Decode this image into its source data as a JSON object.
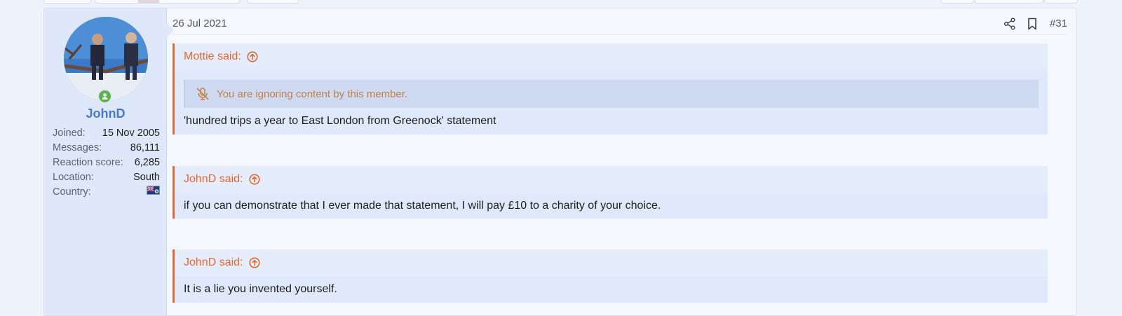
{
  "post": {
    "date": "26 Jul 2021",
    "number": "#31",
    "icons": {
      "share": "share-icon",
      "bookmark": "bookmark-icon",
      "online": "online-status-icon"
    }
  },
  "user": {
    "name": "JohnD",
    "stats": [
      {
        "label": "Joined:",
        "value": "15 Nov 2005"
      },
      {
        "label": "Messages:",
        "value": "86,111"
      },
      {
        "label": "Reaction score:",
        "value": "6,285"
      },
      {
        "label": "Location:",
        "value": "South"
      },
      {
        "label": "Country:",
        "value": ""
      }
    ]
  },
  "quotes": [
    {
      "author": "Mottie said:",
      "ignored_notice": "You are ignoring content by this member.",
      "text": "'hundred trips a year to East London from Greenock' statement"
    },
    {
      "author": "JohnD said:",
      "text": "if you can demonstrate that I ever made that statement, I will pay £10 to a charity of your choice."
    },
    {
      "author": "JohnD said:",
      "text": "It is a lie you invented yourself."
    }
  ],
  "colors": {
    "accent": "#e3672f",
    "username": "#4978c6",
    "quote_bg": "#e0e9fb"
  }
}
